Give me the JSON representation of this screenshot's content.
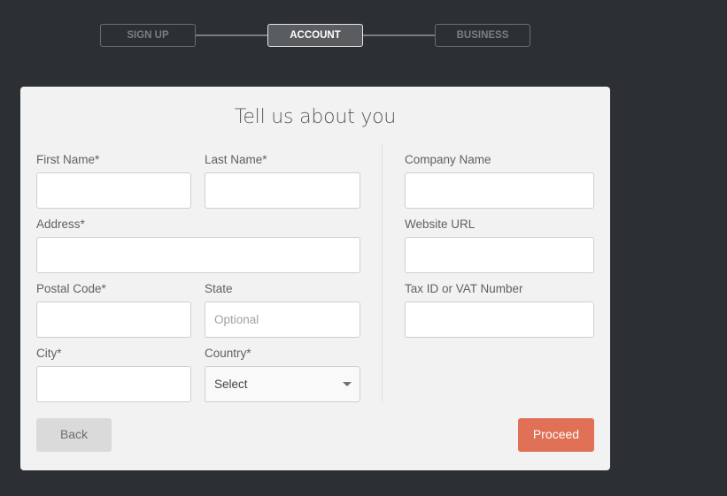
{
  "stepper": {
    "steps": [
      {
        "label": "SIGN UP",
        "state": "inactive"
      },
      {
        "label": "ACCOUNT",
        "state": "active"
      },
      {
        "label": "BUSINESS",
        "state": "inactive"
      }
    ]
  },
  "form": {
    "title": "Tell us about you",
    "personal": {
      "first_name": {
        "label": "First Name*",
        "value": ""
      },
      "last_name": {
        "label": "Last Name*",
        "value": ""
      },
      "address": {
        "label": "Address*",
        "value": ""
      },
      "postal_code": {
        "label": "Postal Code*",
        "value": ""
      },
      "state": {
        "label": "State",
        "value": "",
        "placeholder": "Optional"
      },
      "city": {
        "label": "City*",
        "value": ""
      },
      "country": {
        "label": "Country*",
        "selected": "Select"
      }
    },
    "business": {
      "company_name": {
        "label": "Company Name",
        "value": ""
      },
      "website_url": {
        "label": "Website URL",
        "value": ""
      },
      "tax_id": {
        "label": "Tax ID or VAT Number",
        "value": ""
      }
    },
    "buttons": {
      "back": "Back",
      "proceed": "Proceed"
    }
  },
  "colors": {
    "background": "#2c2f33",
    "card": "#f2f2f2",
    "accent": "#e07056",
    "active_step": "#5a5d60"
  }
}
